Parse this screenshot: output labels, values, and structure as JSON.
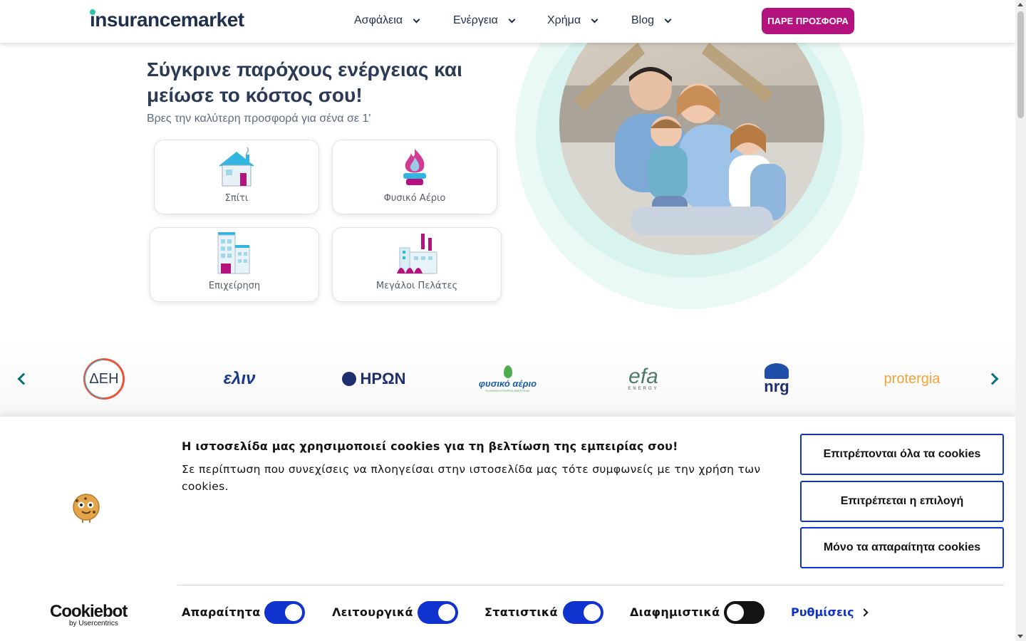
{
  "header": {
    "logo": "insurancemarket",
    "nav": [
      {
        "label": "Ασφάλεια"
      },
      {
        "label": "Ενέργεια"
      },
      {
        "label": "Χρήμα"
      },
      {
        "label": "Blog"
      }
    ],
    "cta_label": "ΠΑΡΕ ΠΡΟΣΦΟΡΑ"
  },
  "hero": {
    "title": "Σύγκρινε παρόχους ενέργειας και μείωσε το κόστος σου!",
    "subtitle": "Βρες την καλύτερη προσφορά για σένα σε 1'",
    "cards": [
      {
        "label": "Σπίτι",
        "icon": "house-icon"
      },
      {
        "label": "Φυσικό Αέριο",
        "icon": "gas-flame-icon"
      },
      {
        "label": "Επιχείρηση",
        "icon": "business-building-icon"
      },
      {
        "label": "Μεγάλοι Πελάτες",
        "icon": "factory-icon"
      }
    ]
  },
  "partners": {
    "logos": [
      "ΔΕΗ",
      "ελιν",
      "ΗΡΩΝ",
      "φυσικό αέριο",
      "efa",
      "nrg",
      "protergia"
    ],
    "efa_sub": "ENERGY",
    "fysiko_sub": "ΕΛΛΗΝΙΚΗ ΕΤΑΙΡΕΙΑ ΕΝΕΡΓΕΙΑΣ"
  },
  "cookie": {
    "title": "Η ιστοσελίδα μας χρησιμοποιεί cookies για τη βελτίωση της εμπειρίας σου!",
    "text": "Σε περίπτωση που συνεχίσεις να πλοηγείσαι στην ιστοσελίδα μας τότε συμφωνείς με την χρήση των cookies.",
    "buttons": {
      "allow_all": "Επιτρέπονται όλα τα cookies",
      "allow_selection": "Επιτρέπεται η επιλογή",
      "necessary_only": "Μόνο τα απαραίτητα cookies"
    },
    "toggles": [
      {
        "label": "Απαραίτητα",
        "state": "on"
      },
      {
        "label": "Λειτουργικά",
        "state": "on"
      },
      {
        "label": "Στατιστικά",
        "state": "on"
      },
      {
        "label": "Διαφημιστικά",
        "state": "off"
      }
    ],
    "settings_label": "Ρυθμίσεις",
    "brand": "Cookiebot",
    "brand_by": "by Usercentrics"
  },
  "colors": {
    "brand_magenta": "#b4127e",
    "teal": "#2ac4b3",
    "navy": "#1f2f4d",
    "cookie_blue": "#1032cf"
  }
}
